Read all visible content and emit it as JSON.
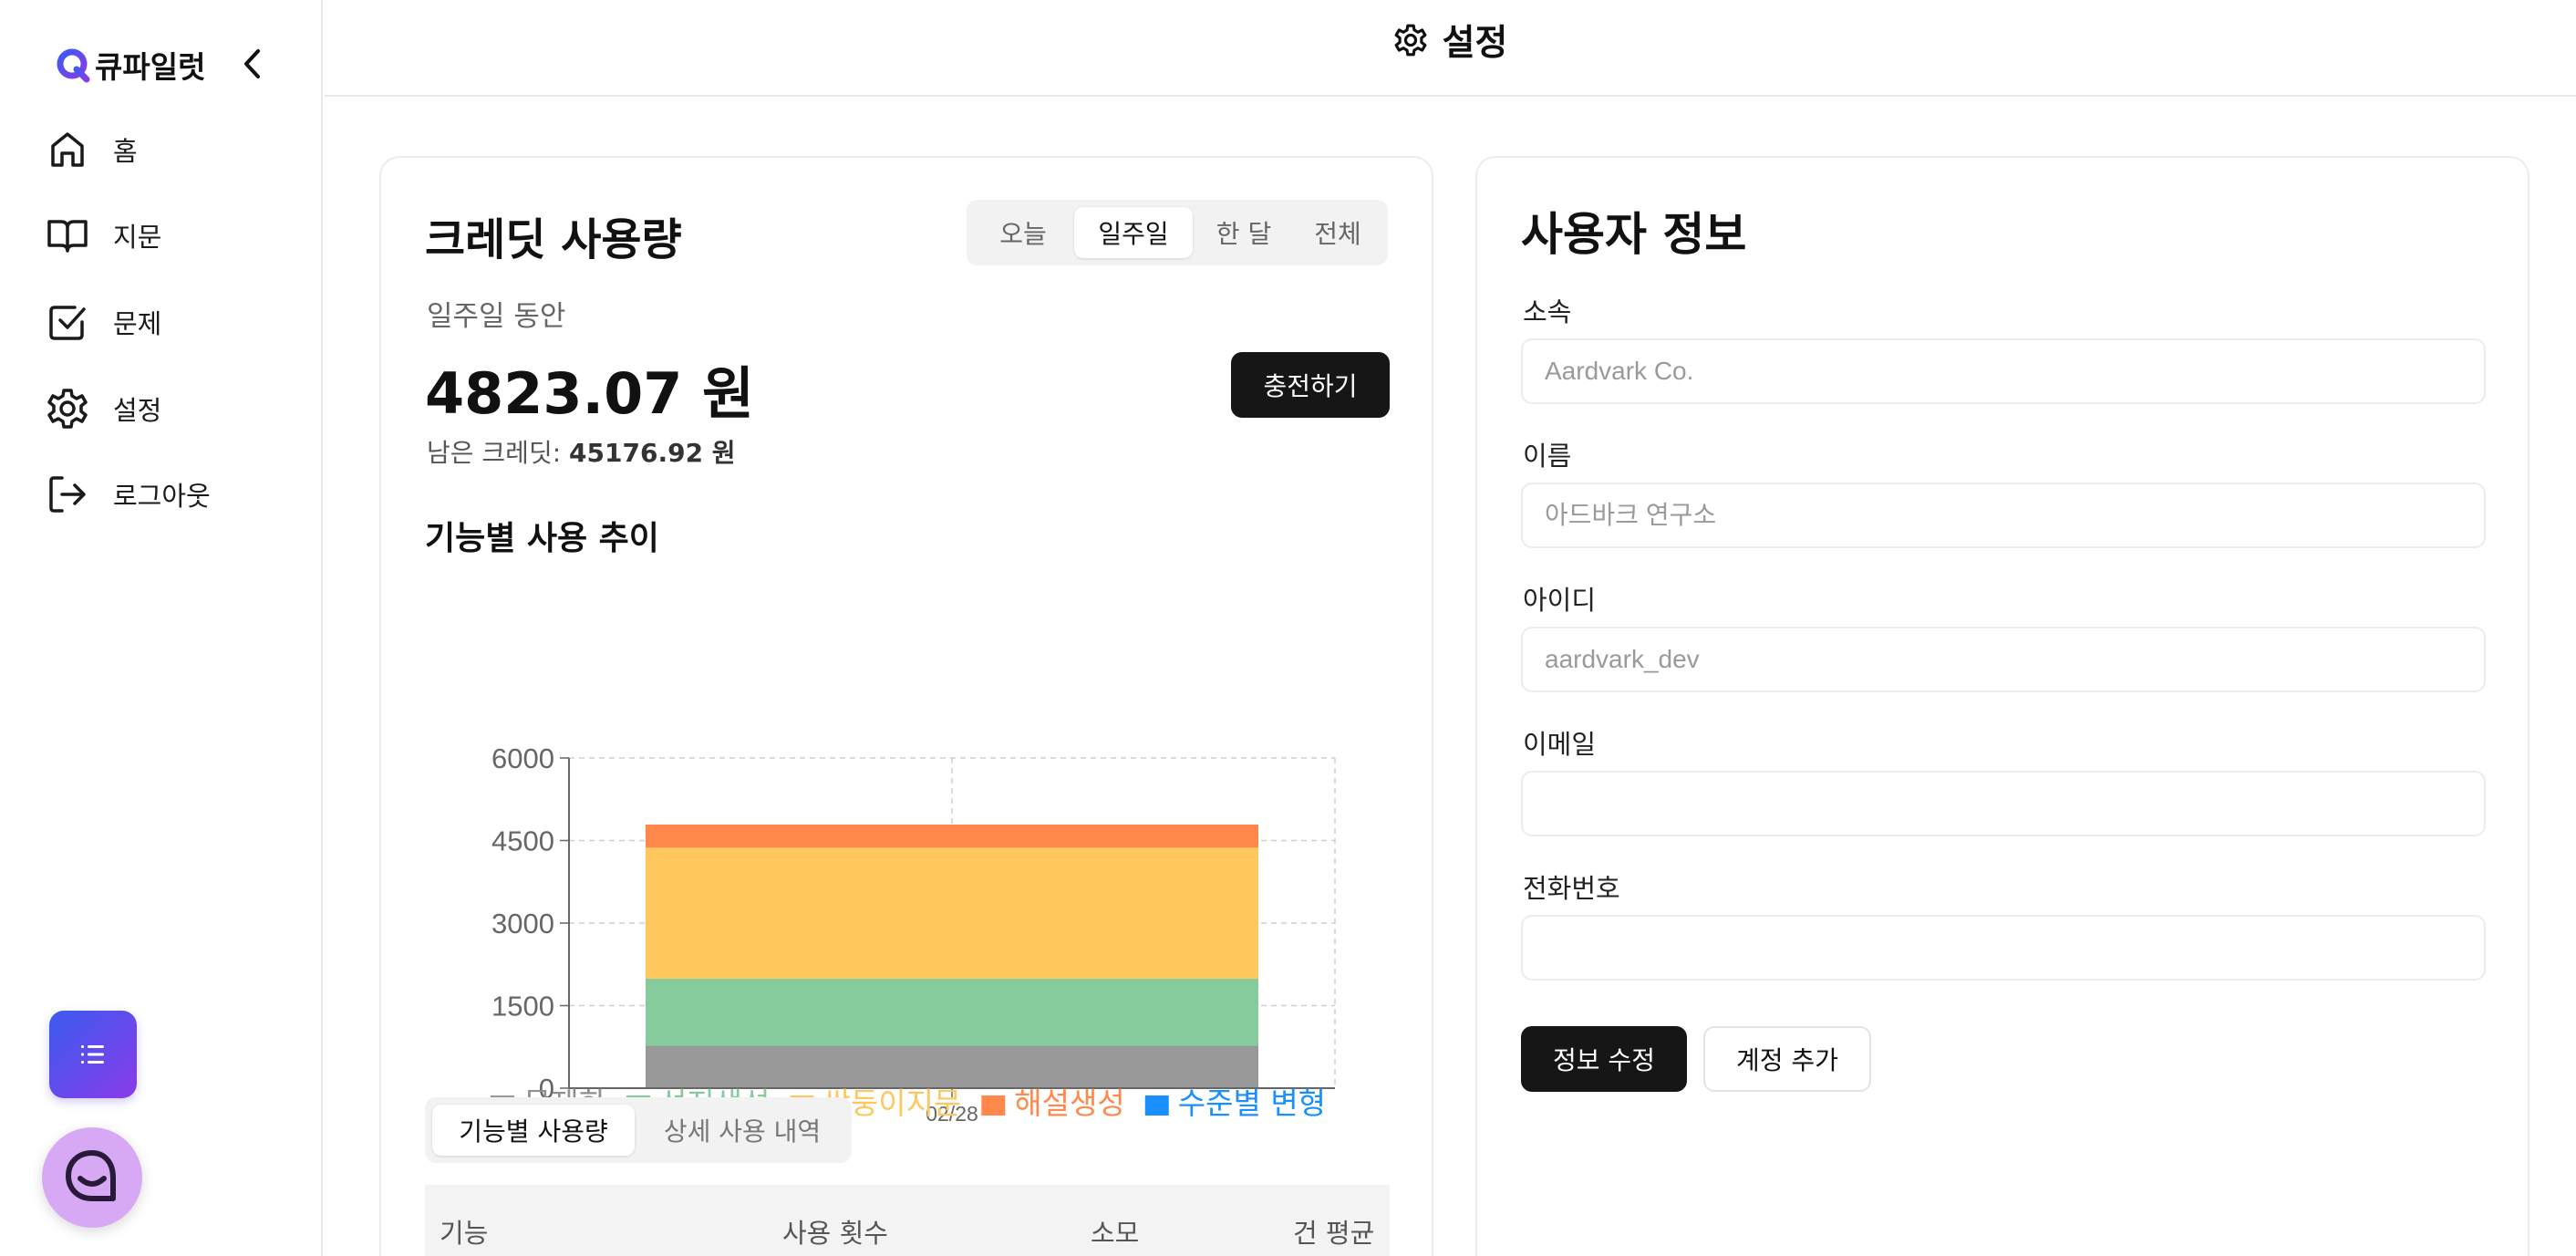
{
  "app": {
    "name": "큐파일럿"
  },
  "sidebar": {
    "items": [
      {
        "label": "홈",
        "icon": "home-icon"
      },
      {
        "label": "지문",
        "icon": "book-icon"
      },
      {
        "label": "문제",
        "icon": "checkbox-icon"
      },
      {
        "label": "설정",
        "icon": "gear-icon"
      },
      {
        "label": "로그아웃",
        "icon": "logout-icon"
      }
    ]
  },
  "header": {
    "title": "설정",
    "icon": "gear-icon"
  },
  "credit": {
    "title": "크레딧 사용량",
    "period_tabs": [
      "오늘",
      "일주일",
      "한 달",
      "전체"
    ],
    "active_period": "일주일",
    "period_label": "일주일 동안",
    "amount": "4823.07 원",
    "remaining_label": "남은 크레딧:",
    "remaining_value": "45176.92 원",
    "charge_button": "충전하기",
    "trend_title": "기능별 사용 추이",
    "sub_tabs": [
      "기능별 사용량",
      "상세 사용 내역"
    ],
    "active_sub_tab": "기능별 사용량",
    "table_headers": [
      "기능",
      "사용 횟수",
      "소모",
      "건 평균"
    ]
  },
  "chart_data": {
    "type": "bar",
    "stacked": true,
    "categories": [
      "02/28"
    ],
    "series": [
      {
        "name": "문제화",
        "values": [
          770
        ],
        "color": "#999999"
      },
      {
        "name": "선지생성",
        "values": [
          1220
        ],
        "color": "#86cb9c"
      },
      {
        "name": "쌍둥이지문",
        "values": [
          2380
        ],
        "color": "#ffc75c"
      },
      {
        "name": "해설생성",
        "values": [
          420
        ],
        "color": "#ff884a"
      },
      {
        "name": "수준별 변형",
        "values": [
          0
        ],
        "color": "#1a8fff"
      }
    ],
    "yticks": [
      "0",
      "1500",
      "3000",
      "4500",
      "6000"
    ],
    "ylim": [
      0,
      6000
    ],
    "grid": true,
    "legend": "bottom"
  },
  "user": {
    "title": "사용자 정보",
    "fields": [
      {
        "label": "소속",
        "value": "",
        "placeholder": "Aardvark Co."
      },
      {
        "label": "이름",
        "value": "",
        "placeholder": "아드바크 연구소"
      },
      {
        "label": "아이디",
        "value": "",
        "placeholder": "aardvark_dev"
      },
      {
        "label": "이메일",
        "value": "",
        "placeholder": ""
      },
      {
        "label": "전화번호",
        "value": "",
        "placeholder": ""
      }
    ],
    "save_button": "정보 수정",
    "add_account_button": "계정 추가"
  },
  "colors": {
    "primary": "#161616",
    "accent_gradient_start": "#3b5bf0",
    "accent_gradient_end": "#8a3be8",
    "chat_fab": "#d7a9f5"
  }
}
